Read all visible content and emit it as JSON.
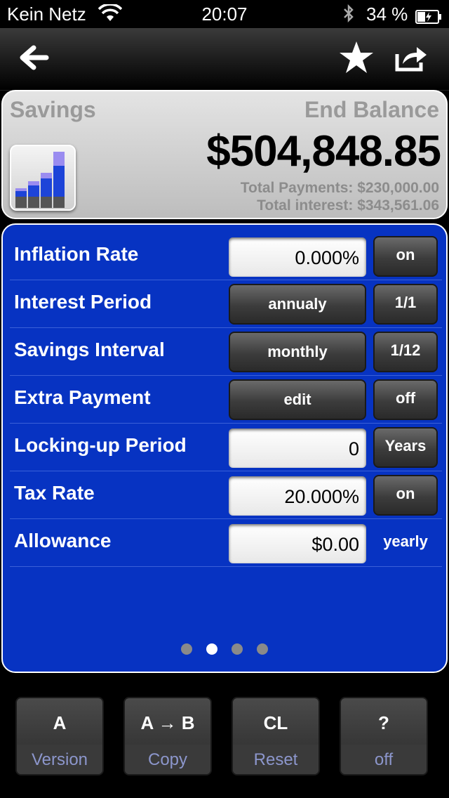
{
  "status": {
    "carrier": "Kein Netz",
    "time": "20:07",
    "battery": "34 %"
  },
  "summary": {
    "left_label": "Savings",
    "right_label": "End Balance",
    "end_balance": "$504,848.85",
    "total_payments": "Total Payments: $230,000.00",
    "total_interest": "Total interest: $343,561.06"
  },
  "rows": [
    {
      "label": "Inflation Rate",
      "value": "0.000%",
      "toggle": "on"
    },
    {
      "label": "Interest Period",
      "value": "annualy",
      "toggle": "1/1"
    },
    {
      "label": "Savings Interval",
      "value": "monthly",
      "toggle": "1/12"
    },
    {
      "label": "Extra Payment",
      "value": "edit",
      "toggle": "off"
    },
    {
      "label": "Locking-up Period",
      "value": "0",
      "toggle": "Years"
    },
    {
      "label": "Tax Rate",
      "value": "20.000%",
      "toggle": "on"
    },
    {
      "label": "Allowance",
      "value": "$0.00",
      "toggle": "yearly"
    }
  ],
  "pager": {
    "count": 4,
    "active": 1
  },
  "bottom_buttons": [
    {
      "top": "A",
      "bottom": "Version"
    },
    {
      "top": "A → B",
      "bottom": "Copy"
    },
    {
      "top": "CL",
      "bottom": "Reset"
    },
    {
      "top": "?",
      "bottom": "off"
    }
  ],
  "icons": {
    "back": "back-arrow-icon",
    "favorite": "star-icon",
    "share": "share-icon",
    "chart": "bar-chart-icon"
  },
  "colors": {
    "panel_blue": "#0733c2",
    "summary_bg": "#cfcfcf",
    "button_dark": "#3c3c3c",
    "bottom_label": "#8c96cc"
  }
}
